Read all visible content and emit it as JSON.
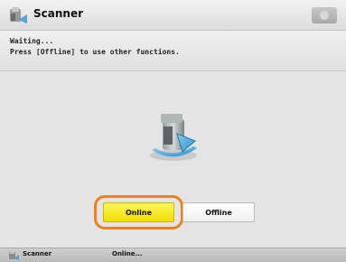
{
  "window": {
    "title": "Scanner",
    "title_icon": "scanner-icon",
    "corner_button_icon": "circle-icon"
  },
  "message": {
    "line1": "Waiting...",
    "line2": "Press [Offline] to use other functions."
  },
  "illustration": {
    "icon": "scanner-network-icon"
  },
  "buttons": {
    "online_label": "Online",
    "offline_label": "Offline",
    "selected": "Online"
  },
  "statusbar": {
    "icon": "scanner-icon",
    "name": "Scanner",
    "text": "Online..."
  },
  "colors": {
    "selected_button": "#f4e600",
    "highlight_ring": "#f08014",
    "arrow": "#4fa8d8"
  }
}
